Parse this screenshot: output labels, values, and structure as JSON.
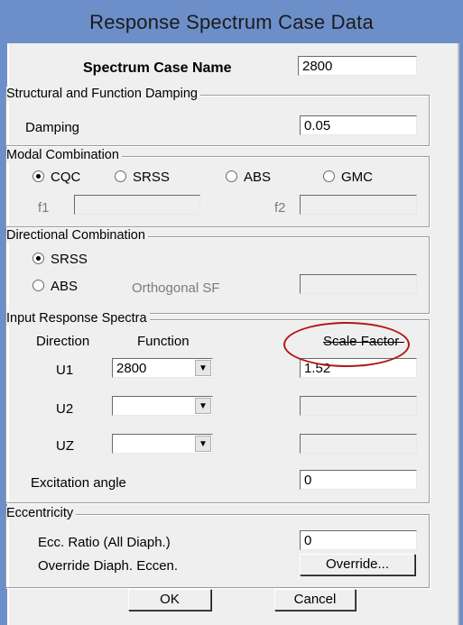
{
  "window": {
    "title": "Response Spectrum Case Data"
  },
  "spectrum_case": {
    "label": "Spectrum Case Name",
    "value": "2800"
  },
  "damping_group": {
    "title": "Structural and Function Damping",
    "damping_label": "Damping",
    "damping_value": "0.05"
  },
  "modal_combination": {
    "title": "Modal Combination",
    "options": [
      {
        "label": "CQC",
        "selected": true
      },
      {
        "label": "SRSS",
        "selected": false
      },
      {
        "label": "ABS",
        "selected": false
      },
      {
        "label": "GMC",
        "selected": false
      }
    ],
    "f1_label": "f1",
    "f1_value": "",
    "f2_label": "f2",
    "f2_value": ""
  },
  "directional_combination": {
    "title": "Directional Combination",
    "options": [
      {
        "label": "SRSS",
        "selected": true
      },
      {
        "label": "ABS",
        "selected": false
      }
    ],
    "orthogonal_label": "Orthogonal SF",
    "orthogonal_value": ""
  },
  "input_spectra": {
    "title": "Input Response Spectra",
    "col_direction": "Direction",
    "col_function": "Function",
    "col_scale": "Scale Factor",
    "rows": [
      {
        "direction": "U1",
        "function": "2800",
        "scale": "1.52"
      },
      {
        "direction": "U2",
        "function": "",
        "scale": ""
      },
      {
        "direction": "UZ",
        "function": "",
        "scale": ""
      }
    ],
    "excitation_label": "Excitation  angle",
    "excitation_value": "0"
  },
  "eccentricity": {
    "title": "Eccentricity",
    "ratio_label": "Ecc. Ratio (All Diaph.)",
    "ratio_value": "0",
    "override_label": "Override Diaph. Eccen.",
    "override_button": "Override..."
  },
  "buttons": {
    "ok": "OK",
    "cancel": "Cancel"
  },
  "annotation": {
    "highlight_color": "#b01818"
  }
}
